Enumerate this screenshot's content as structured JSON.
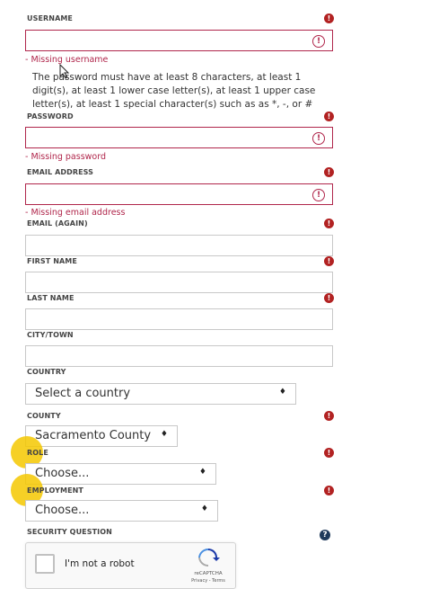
{
  "username": {
    "label": "USERNAME",
    "error": "- Missing username",
    "help": "The password must have at least 8 characters, at least 1 digit(s), at least 1 lower case letter(s), at least 1 upper case letter(s), at least 1 special character(s) such as as *, -, or #"
  },
  "password": {
    "label": "PASSWORD",
    "error": "- Missing password"
  },
  "email": {
    "label": "EMAIL ADDRESS",
    "error": "- Missing email address"
  },
  "email_again": {
    "label": "EMAIL (AGAIN)"
  },
  "first_name": {
    "label": "FIRST NAME"
  },
  "last_name": {
    "label": "LAST NAME"
  },
  "city": {
    "label": "CITY/TOWN"
  },
  "country": {
    "label": "COUNTRY",
    "value": "Select a country"
  },
  "county": {
    "label": "COUNTY",
    "value": "Sacramento County"
  },
  "role": {
    "label": "ROLE",
    "value": "Choose..."
  },
  "employment": {
    "label": "EMPLOYMENT",
    "value": "Choose..."
  },
  "security": {
    "label": "SECURITY QUESTION"
  },
  "captcha": {
    "label": "I'm not a robot",
    "brand": "reCAPTCHA",
    "links": "Privacy - Terms"
  },
  "icons": {
    "required": "!",
    "error": "!",
    "help": "?",
    "dropdown": "♦"
  },
  "colors": {
    "error": "#b0264b",
    "required": "#b22222",
    "highlight": "#f5c800"
  }
}
